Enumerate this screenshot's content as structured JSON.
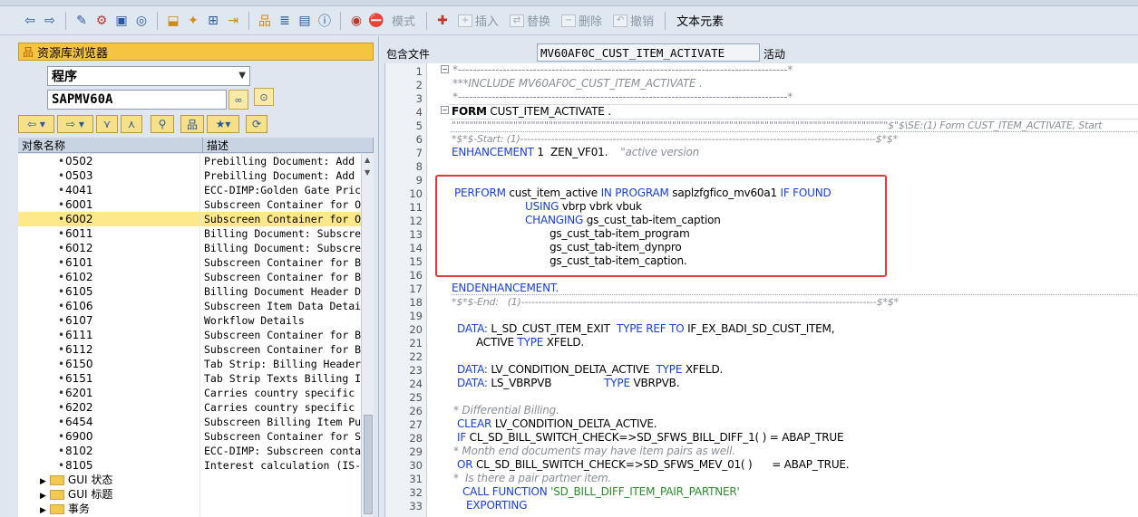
{
  "toolbar": {
    "mode_label": "模式",
    "insert_label": "插入",
    "replace_label": "替换",
    "delete_label": "删除",
    "undo_label": "撤销",
    "text_elements_label": "文本元素"
  },
  "left_pane": {
    "title": "资源库浏览器",
    "object_type": "程序",
    "object_name": "SAPMV60A",
    "columns": [
      "对象名称",
      "描述"
    ],
    "rows": [
      {
        "name": "0502",
        "desc": "Prebilling Document: Add sales"
      },
      {
        "name": "0503",
        "desc": "Prebilling Document: Add manu"
      },
      {
        "name": "4041",
        "desc": "ECC-DIMP:Golden Gate Price Pr"
      },
      {
        "name": "6001",
        "desc": "Subscreen Container for Overvi"
      },
      {
        "name": "6002",
        "desc": "Subscreen Container for Overvi",
        "selected": true
      },
      {
        "name": "6011",
        "desc": "Billing Document: Subscreen, G"
      },
      {
        "name": "6012",
        "desc": "Billing Document: Subscreen, G"
      },
      {
        "name": "6101",
        "desc": "Subscreen Container for BAdI L"
      },
      {
        "name": "6102",
        "desc": "Subscreen Container for BAdI L"
      },
      {
        "name": "6105",
        "desc": "Billing Document Header Detail"
      },
      {
        "name": "6106",
        "desc": "Subscreen Item Data Detail"
      },
      {
        "name": "6107",
        "desc": "Workflow Details"
      },
      {
        "name": "6111",
        "desc": "Subscreen Container for BAdI L"
      },
      {
        "name": "6112",
        "desc": "Subscreen Container for BAdI L"
      },
      {
        "name": "6150",
        "desc": "Tab Strip: Billing Header Texts"
      },
      {
        "name": "6151",
        "desc": "Tab Strip Texts Billing Item"
      },
      {
        "name": "6201",
        "desc": "Carries country specific detail sc"
      },
      {
        "name": "6202",
        "desc": "Carries country specific detail sc"
      },
      {
        "name": "6454",
        "desc": "Subscreen Billing Item Purchasir"
      },
      {
        "name": "6900",
        "desc": "Subscreen Container for Subscr"
      },
      {
        "name": "8102",
        "desc": "ECC-DIMP: Subscreen container"
      },
      {
        "name": "8105",
        "desc": "Interest calculation (IS-Oil SDP"
      }
    ],
    "folders": [
      "GUI 状态",
      "GUI 标题",
      "事务"
    ]
  },
  "editor": {
    "include_label": "包含文件",
    "include_name": "MV60AF0C_CUST_ITEM_ACTIVATE",
    "status": "活动",
    "lines": [
      {
        "n": "1"
      },
      {
        "n": "2"
      },
      {
        "n": "3"
      },
      {
        "n": "4"
      },
      {
        "n": "5"
      },
      {
        "n": "6"
      },
      {
        "n": "7"
      },
      {
        "n": "8"
      },
      {
        "n": "9"
      },
      {
        "n": "10"
      },
      {
        "n": "11"
      },
      {
        "n": "12"
      },
      {
        "n": "13"
      },
      {
        "n": "14"
      },
      {
        "n": "15"
      },
      {
        "n": "16"
      },
      {
        "n": "17"
      },
      {
        "n": "18"
      },
      {
        "n": "19"
      },
      {
        "n": "20"
      },
      {
        "n": "21"
      },
      {
        "n": "22"
      },
      {
        "n": "23"
      },
      {
        "n": "24"
      },
      {
        "n": "25"
      },
      {
        "n": "26"
      },
      {
        "n": "27"
      },
      {
        "n": "28"
      },
      {
        "n": "29"
      },
      {
        "n": "30"
      },
      {
        "n": "31"
      },
      {
        "n": "32"
      },
      {
        "n": "33"
      }
    ],
    "code": {
      "l1": "*----------------------------------------------------------------------------------------*",
      "l2": "***INCLUDE MV60AF0C_CUST_ITEM_ACTIVATE .",
      "l3": "*----------------------------------------------------------------------------------------*",
      "l4_kw": "FORM",
      "l4_rest": " CUST_ITEM_ACTIVATE .",
      "l5": "\"\"\"\"\"\"\"\"\"\"\"\"\"\"\"\"\"\"\"\"\"\"\"\"\"\"\"\"\"\"\"\"\"\"\"\"\"\"\"\"\"\"\"\"\"\"\"\"\"\"\"\"\"\"\"\"\"\"\"\"\"\"\"\"\"\"\"\"\"\"\"\"\"\"\"\"\"\"\"\"\"\"\"\"\"\"\"\"\"\"\"\"\"\"\"\"\"\"\"$\"$\\SE:(1) Form CUST_ITEM_ACTIVATE, Start",
      "l6": "*$*$-Start: (1)--------------------------------------------------------------------------------------------------------$*$*",
      "l7_kw": "ENHANCEMENT",
      "l7_rest": " 1  ZEN_VF01.",
      "l7_cm": "\"active version",
      "l10_kw1": "PERFORM",
      "l10_mid": " cust_item_active ",
      "l10_kw2": "IN PROGRAM",
      "l10_mid2": " saplzfgfico_mv60a1 ",
      "l10_kw3": "IF FOUND",
      "l11_kw": "USING",
      "l11_rest": " vbrp vbrk vbuk",
      "l12_kw": "CHANGING",
      "l12_rest": " gs_cust_tab-item_caption",
      "l13": "gs_cust_tab-item_program",
      "l14": "gs_cust_tab-item_dynpro",
      "l15": "gs_cust_tab-item_caption.",
      "l17": "ENDENHANCEMENT.",
      "l18": "*$*$-End:   (1)--------------------------------------------------------------------------------------------------------$*$*",
      "l20_kw1": "DATA:",
      "l20_a": " L_SD_CUST_ITEM_EXIT  ",
      "l20_kw2": "TYPE REF TO",
      "l20_b": " IF_EX_BADI_SD_CUST_ITEM,",
      "l21_a": "ACTIVE ",
      "l21_kw": "TYPE",
      "l21_b": " XFELD.",
      "l23_kw1": "DATA:",
      "l23_a": " LV_CONDITION_DELTA_ACTIVE  ",
      "l23_kw2": "TYPE",
      "l23_b": " XFELD.",
      "l24_kw1": "DATA:",
      "l24_a": " LS_VBRPVB                ",
      "l24_kw2": "TYPE",
      "l24_b": " VBRPVB.",
      "l26": "* Differential Billing.",
      "l27_kw": "CLEAR",
      "l27_rest": " LV_CONDITION_DELTA_ACTIVE.",
      "l28_kw": "IF",
      "l28_rest": " CL_SD_BILL_SWITCH_CHECK=>SD_SFWS_BILL_DIFF_1( ) = ABAP_TRUE",
      "l29": "* Month end documents may have item pairs as well.",
      "l30_kw": "OR",
      "l30_rest": " CL_SD_BILL_SWITCH_CHECK=>SD_SFWS_MEV_01( )      = ABAP_TRUE.",
      "l31": "*  Is there a pair partner item.",
      "l32_kw": "CALL FUNCTION",
      "l32_st": " 'SD_BILL_DIFF_ITEM_PAIR_PARTNER'",
      "l33_kw": "EXPORTING"
    }
  }
}
